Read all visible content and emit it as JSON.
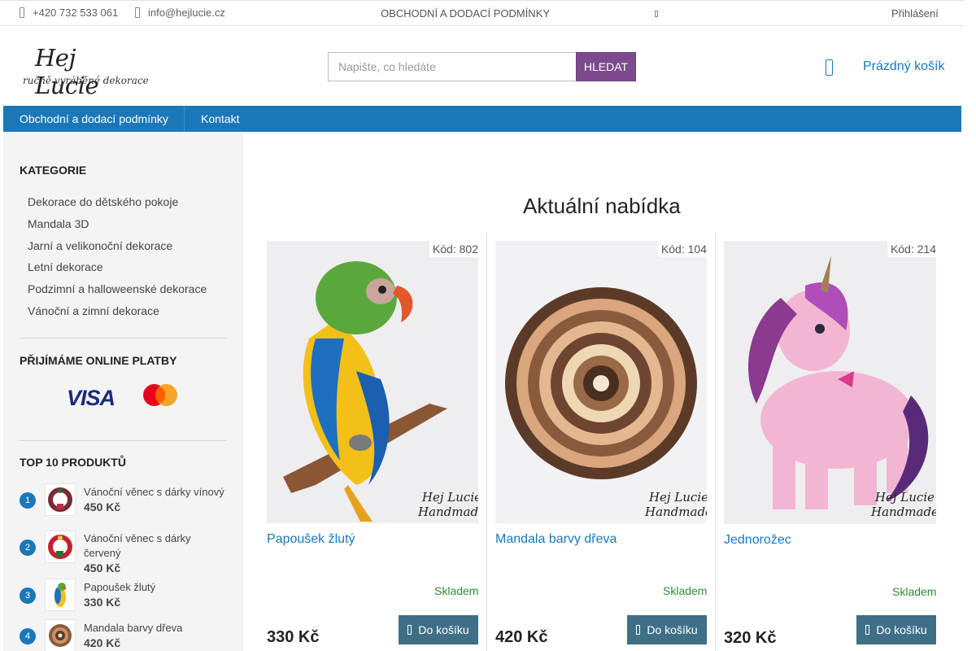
{
  "topbar": {
    "phone": "+420 732 533 061",
    "email": "info@hejlucie.cz",
    "terms_link": "OBCHODNÍ A DODACÍ PODMÍNKY",
    "login": "Přihlášení"
  },
  "header": {
    "logo_title": "Hej Lucie",
    "logo_tagline": "ručně vyráběné dekorace",
    "search_placeholder": "Napište, co hledáte",
    "search_button": "HLEDAT",
    "cart_label": "Prázdný košík"
  },
  "nav": {
    "items": [
      "Obchodní a dodací podmínky",
      "Kontakt"
    ]
  },
  "sidebar": {
    "categories_title": "KATEGORIE",
    "categories": [
      "Dekorace do dětského pokoje",
      "Mandala 3D",
      "Jarní a velikonoční dekorace",
      "Letní dekorace",
      "Podzimní a halloweenské dekorace",
      "Vánoční a zimní dekorace"
    ],
    "payments_title": "PŘIJÍMÁME ONLINE PLATBY",
    "visa_label": "VISA",
    "top_title": "TOP 10 PRODUKTŮ",
    "top_products": [
      {
        "rank": "1",
        "name": "Vánoční věnec s dárky vínový",
        "price": "450 Kč"
      },
      {
        "rank": "2",
        "name": "Vánoční věnec s dárky červený",
        "price": "450 Kč"
      },
      {
        "rank": "3",
        "name": "Papoušek žlutý",
        "price": "330 Kč"
      },
      {
        "rank": "4",
        "name": "Mandala barvy dřeva",
        "price": "420 Kč"
      }
    ]
  },
  "main": {
    "title": "Aktuální nabídka",
    "products": [
      {
        "code": "Kód: 802",
        "name": "Papoušek žlutý",
        "stock": "Skladem",
        "price": "330 Kč",
        "button": "Do košíku",
        "watermark": "Hej Lucie\nHandmade"
      },
      {
        "code": "Kód: 104",
        "name": "Mandala barvy dřeva",
        "stock": "Skladem",
        "price": "420 Kč",
        "button": "Do košíku",
        "watermark": "Hej Lucie\nHandmade"
      },
      {
        "code": "Kód: 214",
        "name": "Jednorožec",
        "stock": "Skladem",
        "price": "320 Kč",
        "button": "Do košíku",
        "watermark": "Hej Lucie\nHandmade"
      }
    ]
  },
  "colors": {
    "accent_blue": "#1a78b8",
    "search_button": "#7d4a8f",
    "buy_button": "#3e6f87",
    "stock_green": "#2f8a3a"
  }
}
